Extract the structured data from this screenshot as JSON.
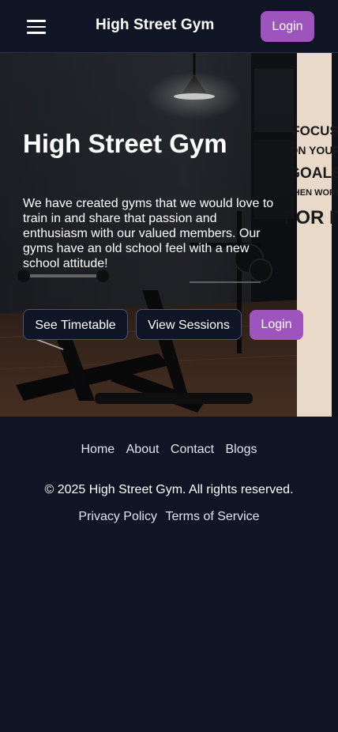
{
  "navbar": {
    "menu_icon": "hamburger-menu-icon",
    "brand": "High Street Gym",
    "login_label": "Login"
  },
  "hero": {
    "title": "High Street Gym",
    "description": "We have created gyms that we would love to train in and share that passion and enthusiasm with our valued members. Our gyms have an old school feel with a new school attitude!",
    "buttons": {
      "timetable": "See Timetable",
      "sessions": "View Sessions",
      "login": "Login"
    },
    "poster_text": [
      "FOCUS",
      "ON YOUR",
      "GOALS",
      "THEN WORK",
      "FOR IT"
    ]
  },
  "footer": {
    "links": [
      "Home",
      "About",
      "Contact",
      "Blogs"
    ],
    "copyright": "© 2025 High Street Gym. All rights reserved.",
    "legal": [
      "Privacy Policy",
      "Terms of Service"
    ]
  },
  "colors": {
    "background": "#0f1525",
    "accent": "#9d55bd",
    "text": "#ffffff"
  }
}
